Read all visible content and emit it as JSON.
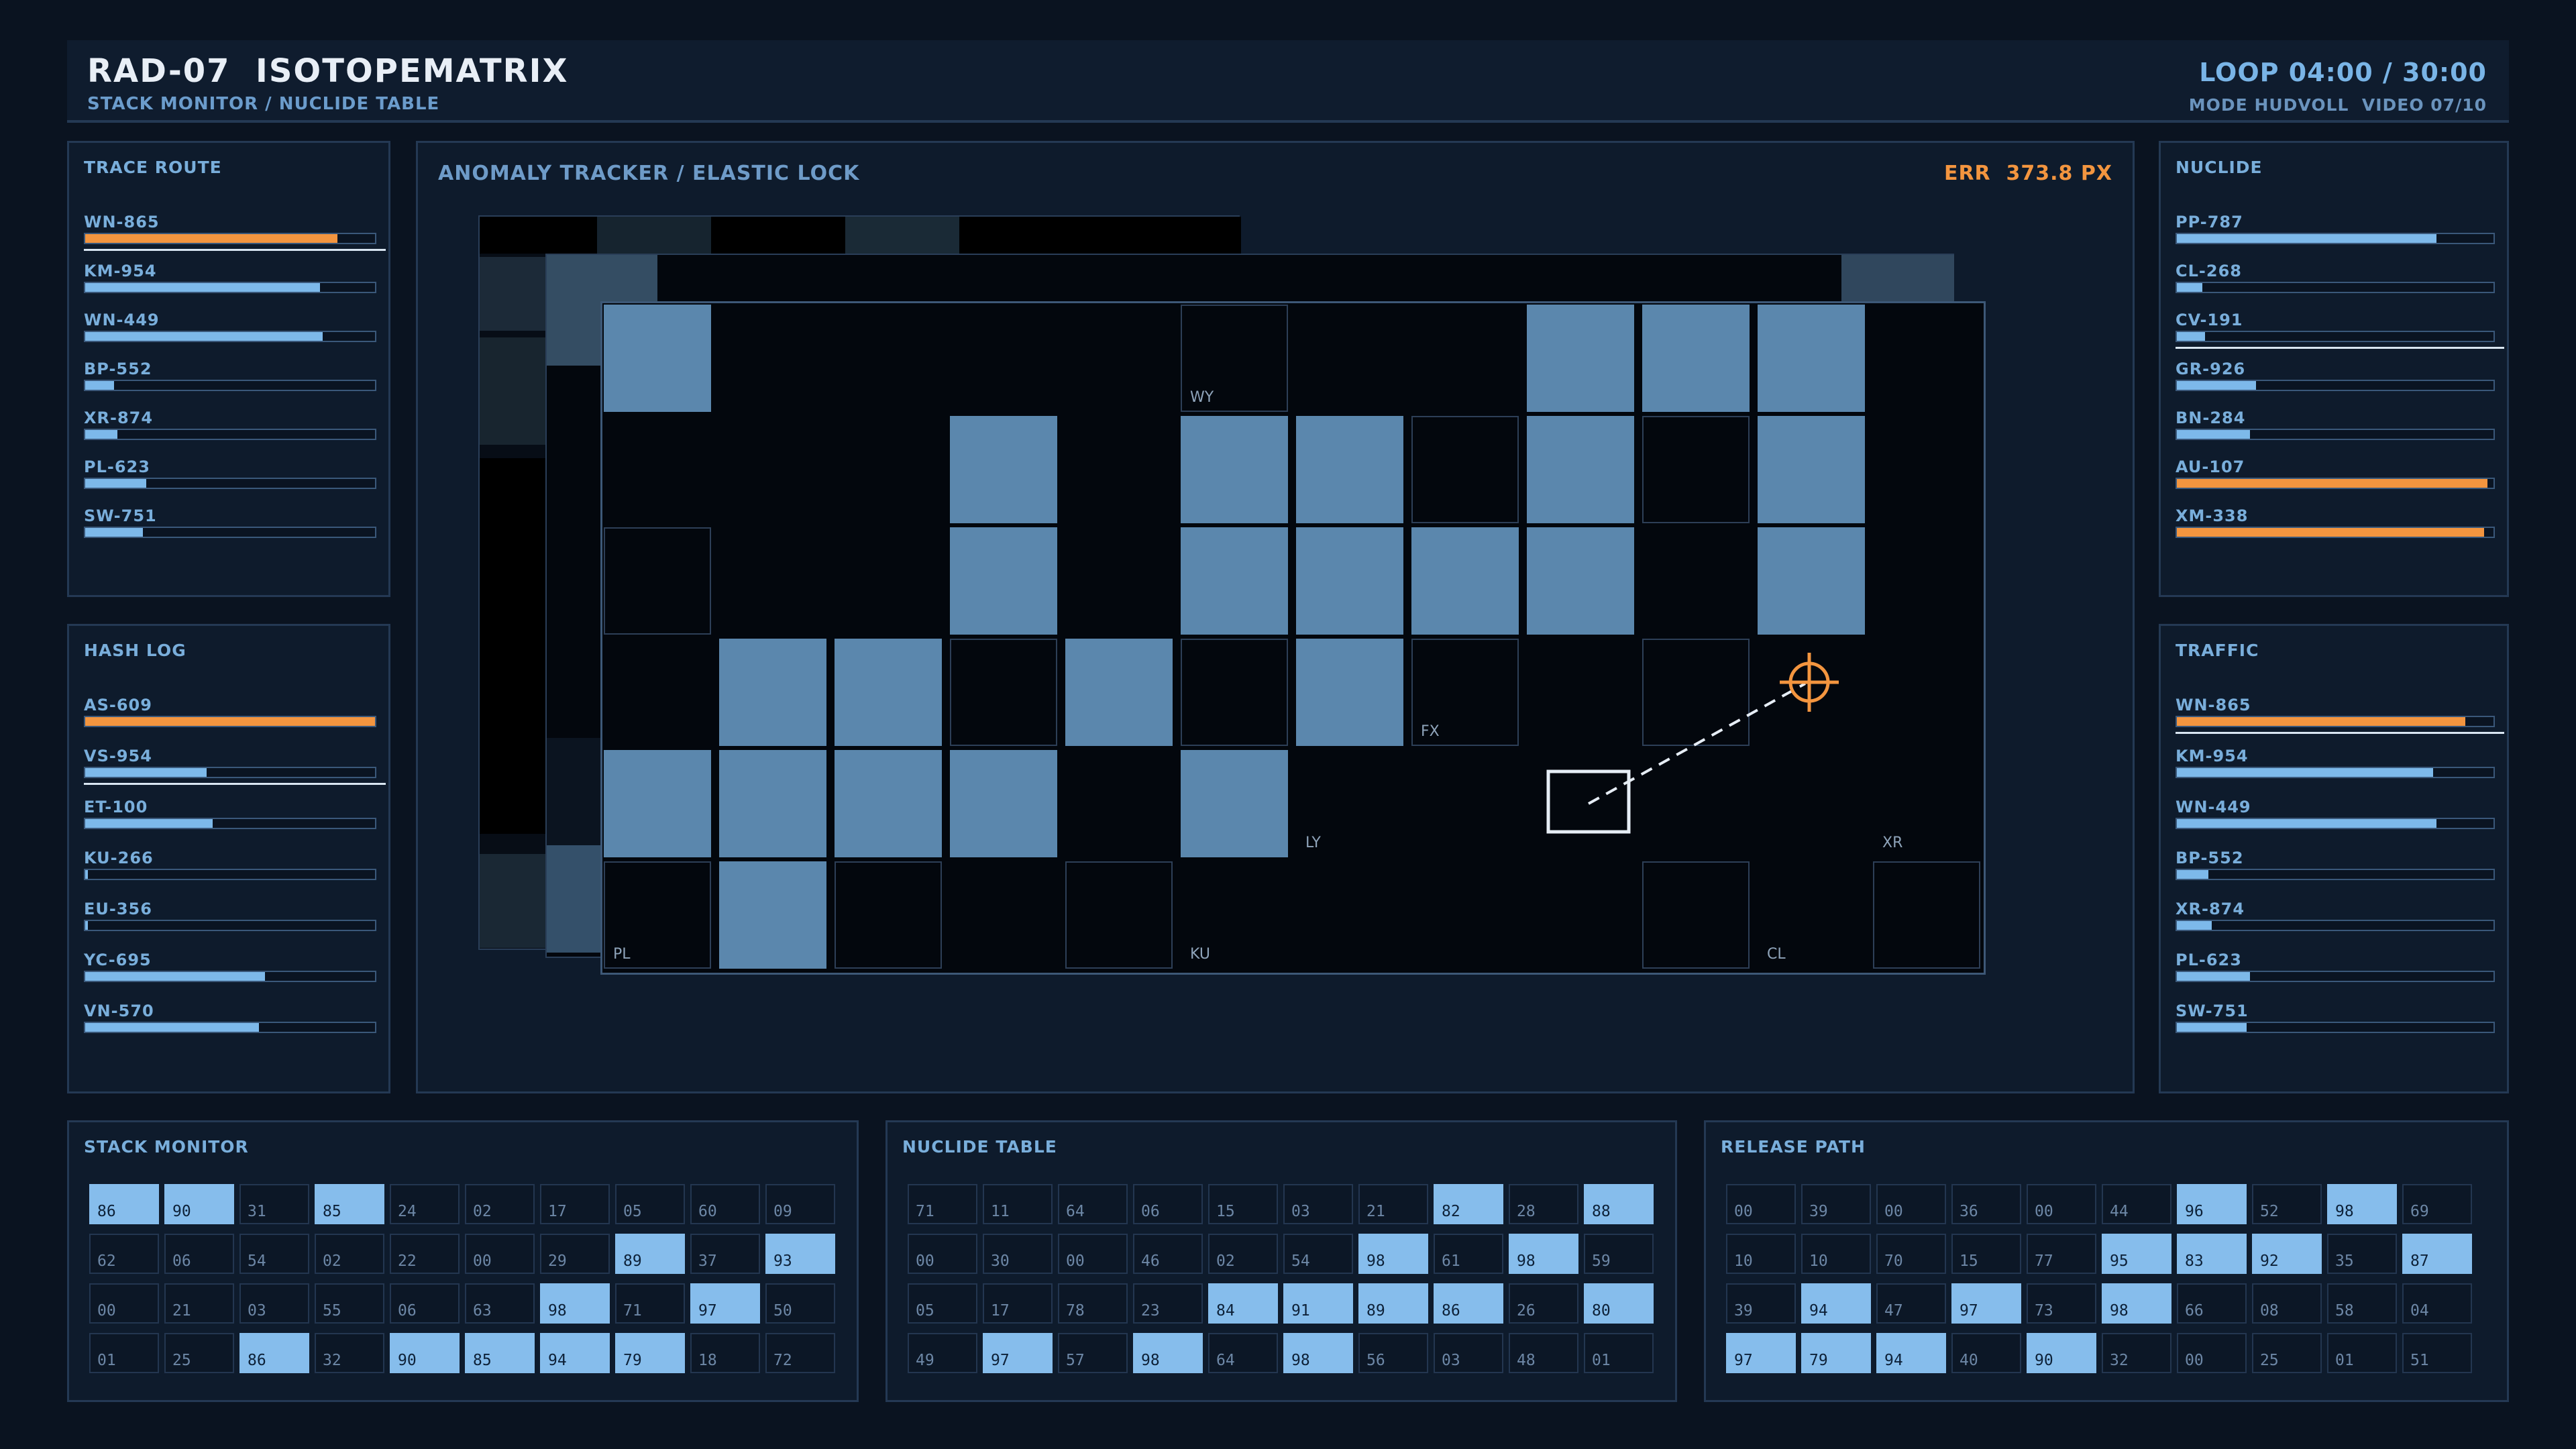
{
  "header": {
    "title": "RAD-07  ISOTOPEMATRIX",
    "subtitle": "STACK MONITOR / NUCLIDE TABLE",
    "loop": "LOOP 04:00 / 30:00",
    "mode": "MODE HUDVOLL  VIDEO 07/10"
  },
  "colors": {
    "accent": "#7db9ea",
    "alert": "#f3953f",
    "panel": "#0e1b2c",
    "background": "#0a1320"
  },
  "trace_route": {
    "title": "TRACE ROUTE",
    "items": [
      {
        "label": "WN-865",
        "value": 0.87,
        "color": "orange"
      },
      {
        "label": "KM-954",
        "value": 0.81
      },
      {
        "label": "WN-449",
        "value": 0.82
      },
      {
        "label": "BP-552",
        "value": 0.1
      },
      {
        "label": "XR-874",
        "value": 0.11
      },
      {
        "label": "PL-623",
        "value": 0.21
      },
      {
        "label": "SW-751",
        "value": 0.2
      }
    ]
  },
  "hash_log": {
    "title": "HASH LOG",
    "items": [
      {
        "label": "AS-609",
        "value": 1.0,
        "color": "orange"
      },
      {
        "label": "VS-954",
        "value": 0.42
      },
      {
        "label": "ET-100",
        "value": 0.44
      },
      {
        "label": "KU-266",
        "value": 0.01
      },
      {
        "label": "EU-356",
        "value": 0.01
      },
      {
        "label": "YC-695",
        "value": 0.62
      },
      {
        "label": "VN-570",
        "value": 0.6
      }
    ]
  },
  "nuclide": {
    "title": "NUCLIDE",
    "items": [
      {
        "label": "PP-787",
        "value": 0.82
      },
      {
        "label": "CL-268",
        "value": 0.08
      },
      {
        "label": "CV-191",
        "value": 0.09
      },
      {
        "label": "GR-926",
        "value": 0.25
      },
      {
        "label": "BN-284",
        "value": 0.23
      },
      {
        "label": "AU-107",
        "value": 0.98,
        "color": "orange"
      },
      {
        "label": "XM-338",
        "value": 0.97,
        "color": "orange"
      }
    ]
  },
  "traffic": {
    "title": "TRAFFIC",
    "items": [
      {
        "label": "WN-865",
        "value": 0.91,
        "color": "orange"
      },
      {
        "label": "KM-954",
        "value": 0.81
      },
      {
        "label": "WN-449",
        "value": 0.82
      },
      {
        "label": "BP-552",
        "value": 0.1
      },
      {
        "label": "XR-874",
        "value": 0.11
      },
      {
        "label": "PL-623",
        "value": 0.23
      },
      {
        "label": "SW-751",
        "value": 0.22
      }
    ]
  },
  "tracker": {
    "title": "ANOMALY TRACKER / ELASTIC LOCK",
    "error": "ERR  373.8 PX",
    "grid": [
      "F....O..FFF",
      "...F.FFOFOF",
      "O..F.FFFF.F.",
      ".FFOFOFO.O..",
      "FFFF.F......",
      "OFO.O....O.O"
    ],
    "labels": [
      "",
      "",
      "",
      "",
      "",
      "WY",
      "",
      "",
      "",
      "",
      "",
      "",
      "",
      "",
      "",
      "",
      "",
      "",
      "",
      "",
      "",
      "",
      "",
      "",
      "",
      "",
      "",
      "",
      "",
      "",
      "",
      "",
      "",
      "",
      "",
      "",
      "",
      "",
      "",
      "",
      "",
      "",
      "",
      "",
      "",
      "",
      "",
      "",
      "",
      "",
      "",
      "",
      "",
      "",
      "",
      "",
      "",
      "",
      "",
      "",
      "",
      "",
      "",
      "",
      "",
      "",
      "",
      "",
      "",
      "",
      "",
      "",
      "",
      "",
      "",
      "",
      "",
      "",
      "",
      "",
      "",
      "",
      "",
      "",
      "",
      "",
      "",
      "",
      "",
      "",
      "",
      ""
    ],
    "cell_labels": [
      {
        "row": 0,
        "col": 5,
        "text": "WY"
      },
      {
        "row": 3,
        "col": 7,
        "text": "FX"
      },
      {
        "row": 4,
        "col": 6,
        "text": "LY"
      },
      {
        "row": 4,
        "col": 11,
        "text": "XR"
      },
      {
        "row": 5,
        "col": 0,
        "text": "PL"
      },
      {
        "row": 5,
        "col": 5,
        "text": "KU"
      },
      {
        "row": 5,
        "col": 10,
        "text": "CL"
      }
    ]
  },
  "stack_monitor": {
    "title": "STACK MONITOR",
    "rows": [
      [
        "86",
        "90",
        "31",
        "85",
        "24",
        "02",
        "17",
        "05",
        "60",
        "09"
      ],
      [
        "62",
        "06",
        "54",
        "02",
        "22",
        "00",
        "29",
        "89",
        "37",
        "93"
      ],
      [
        "00",
        "21",
        "03",
        "55",
        "06",
        "63",
        "98",
        "71",
        "97",
        "50"
      ],
      [
        "01",
        "25",
        "86",
        "32",
        "90",
        "85",
        "94",
        "79",
        "18",
        "72"
      ]
    ]
  },
  "nuclide_table": {
    "title": "NUCLIDE TABLE",
    "rows": [
      [
        "71",
        "11",
        "64",
        "06",
        "15",
        "03",
        "21",
        "82",
        "28",
        "88"
      ],
      [
        "00",
        "30",
        "00",
        "46",
        "02",
        "54",
        "98",
        "61",
        "98",
        "59"
      ],
      [
        "05",
        "17",
        "78",
        "23",
        "84",
        "91",
        "89",
        "86",
        "26",
        "80"
      ],
      [
        "49",
        "97",
        "57",
        "98",
        "64",
        "98",
        "56",
        "03",
        "48",
        "01"
      ]
    ]
  },
  "release_path": {
    "title": "RELEASE PATH",
    "rows": [
      [
        "00",
        "39",
        "00",
        "36",
        "00",
        "44",
        "96",
        "52",
        "98",
        "69"
      ],
      [
        "10",
        "10",
        "70",
        "15",
        "77",
        "95",
        "83",
        "92",
        "35",
        "87"
      ],
      [
        "39",
        "94",
        "47",
        "97",
        "73",
        "98",
        "66",
        "08",
        "58",
        "04"
      ],
      [
        "97",
        "79",
        "94",
        "40",
        "90",
        "32",
        "00",
        "25",
        "01",
        "51"
      ]
    ]
  }
}
